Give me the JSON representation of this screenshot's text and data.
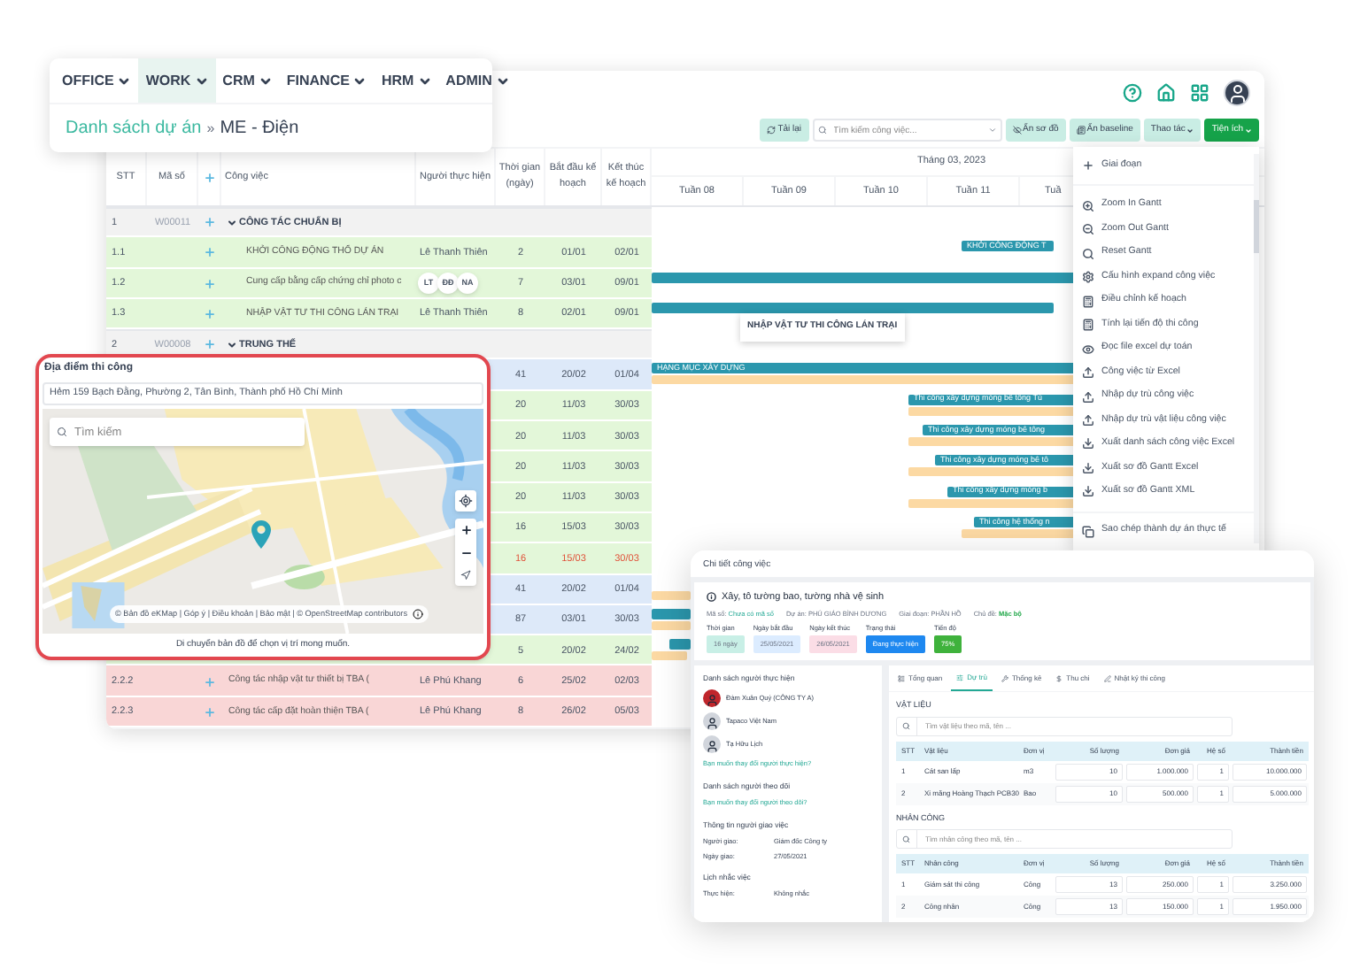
{
  "nav": {
    "menus": [
      {
        "label": "OFFICE",
        "selected": false
      },
      {
        "label": "WORK",
        "selected": true
      },
      {
        "label": "CRM",
        "selected": false
      },
      {
        "label": "FINANCE",
        "selected": false
      },
      {
        "label": "HRM",
        "selected": false
      },
      {
        "label": "ADMIN",
        "selected": false
      }
    ],
    "breadcrumb": {
      "link": "Danh sách dự án",
      "separator": "»",
      "current": "ME - Điện"
    }
  },
  "toolbar": {
    "reload": "Tải lại",
    "search_placeholder": "Tìm kiếm công việc...",
    "buttons": [
      {
        "label": "Ẩn sơ đồ",
        "kind": "light"
      },
      {
        "label": "Ẩn baseline",
        "kind": "light"
      },
      {
        "label": "Thao tác",
        "kind": "menu"
      },
      {
        "label": "Tiện ích",
        "kind": "primary"
      }
    ]
  },
  "table": {
    "columns": [
      "STT",
      "Mã số",
      "Công việc",
      "Người thực hiện",
      "Thời gian (ngày)",
      "Bắt đầu kế hoạch",
      "Kết thúc kế hoạch"
    ],
    "month": "Tháng 03, 2023",
    "weeks": [
      "Tuần 08",
      "Tuần 09",
      "Tuần 10",
      "Tuần 11",
      "Tuầ"
    ],
    "rows": [
      {
        "kind": "group",
        "color": "#f2f2f2",
        "stt": "1",
        "code": "W00011",
        "name": "CÔNG TÁC CHUẨN BỊ",
        "expanded": true,
        "bar": false,
        "baseline": false
      },
      {
        "kind": "task",
        "color": "#e3f7d9",
        "stt": "1.1",
        "name": "KHỞI CÔNG ĐỘNG THỔ DỰ ÁN",
        "assignee": "Lê Thanh Thiên",
        "days": "2",
        "start": "01/01",
        "end": "02/01",
        "late": false,
        "bar": true,
        "bar_label": "KHỞI CÔNG ĐỘNG T",
        "baseline": false
      },
      {
        "kind": "task",
        "color": "#e3f7d9",
        "stt": "1.2",
        "name": "Cung cấp bằng cấp chứng chỉ photo c",
        "avatars": [
          "LT",
          "ĐĐ",
          "NA"
        ],
        "days": "7",
        "start": "03/01",
        "end": "09/01",
        "late": false,
        "bar": true,
        "baseline": false
      },
      {
        "kind": "task",
        "color": "#e3f7d9",
        "stt": "1.3",
        "name": "NHẬP VẬT TƯ THI CÔNG LÁN TRẠI",
        "assignee": "Lê Thanh Thiên",
        "days": "8",
        "start": "02/01",
        "end": "09/01",
        "late": false,
        "bar": true,
        "baseline": false
      },
      {
        "kind": "group",
        "color": "#f2f2f2",
        "stt": "2",
        "code": "W00008",
        "name": "TRUNG THẾ",
        "expanded": true,
        "bar": false,
        "baseline": false
      },
      {
        "kind": "task",
        "color": "#dde9f9",
        "days": "41",
        "start": "20/02",
        "end": "01/04",
        "late": false,
        "bar": true,
        "bar_label": "HẠNG MỤC XÂY DỰNG",
        "baseline": true
      },
      {
        "kind": "task",
        "color": "#e3f7d9",
        "days": "20",
        "start": "11/03",
        "end": "30/03",
        "late": false,
        "bar": true,
        "bar_label": "Thi công xây dựng móng bê tông Tủ",
        "baseline": true
      },
      {
        "kind": "task",
        "color": "#e3f7d9",
        "days": "20",
        "start": "11/03",
        "end": "30/03",
        "late": false,
        "bar": true,
        "bar_label": "Thi công xây dựng móng bê tông",
        "baseline": true
      },
      {
        "kind": "task",
        "color": "#e3f7d9",
        "days": "20",
        "start": "11/03",
        "end": "30/03",
        "late": false,
        "bar": true,
        "bar_label": "Thi công xây dựng móng bê tô",
        "baseline": true
      },
      {
        "kind": "task",
        "color": "#e3f7d9",
        "days": "20",
        "start": "11/03",
        "end": "30/03",
        "late": false,
        "bar": true,
        "bar_label": "Thi công xây dựng móng b",
        "baseline": true
      },
      {
        "kind": "task",
        "color": "#e3f7d9",
        "days": "16",
        "start": "15/03",
        "end": "30/03",
        "late": false,
        "bar": true,
        "bar_label": "Thi công hệ thống n",
        "baseline": true
      },
      {
        "kind": "task",
        "color": "#e3f7d9",
        "days": "16",
        "start": "15/03",
        "end": "30/03",
        "late": true,
        "bar": false,
        "baseline": false
      },
      {
        "kind": "task",
        "color": "#dde9f9",
        "days": "41",
        "start": "20/02",
        "end": "01/04",
        "late": false,
        "bar": false,
        "baseline": true
      },
      {
        "kind": "task",
        "color": "#dde9f9",
        "days": "87",
        "start": "03/01",
        "end": "30/03",
        "late": false,
        "bar": true,
        "baseline": true
      },
      {
        "kind": "task",
        "color": "#e3f7d9",
        "days": "5",
        "start": "20/02",
        "end": "24/02",
        "late": false,
        "bar": true,
        "baseline": true
      },
      {
        "kind": "task",
        "color": "#f9d6d6",
        "stt": "2.2.2",
        "name": "Công tác nhập vật tư thiết bị TBA (",
        "assignee": "Lê Phú Khang",
        "days": "6",
        "start": "25/02",
        "end": "02/03",
        "late": false,
        "bar": false,
        "baseline": false
      },
      {
        "kind": "task",
        "color": "#f9d6d6",
        "stt": "2.2.3",
        "name": "Công tác cấp đặt hoàn thiện TBA (",
        "assignee": "Lê Phú Khang",
        "days": "8",
        "start": "26/02",
        "end": "05/03",
        "late": false,
        "bar": false,
        "baseline": false
      }
    ],
    "tooltip": "NHẬP VẬT TƯ THI CÔNG LÁN TRẠI"
  },
  "menu": {
    "items": [
      {
        "label": "Giai đoạn",
        "kind": "plus"
      },
      {
        "kind": "divider"
      },
      {
        "label": "Zoom In Gantt",
        "kind": "zoom-in"
      },
      {
        "label": "Zoom Out Gantt",
        "kind": "zoom-out"
      },
      {
        "label": "Reset Gantt",
        "kind": "search"
      },
      {
        "label": "Cấu hình expand công việc",
        "kind": "gear"
      },
      {
        "label": "Điều chỉnh kế hoạch",
        "kind": "half"
      },
      {
        "label": "Tính lại tiến độ thi công",
        "kind": "calc"
      },
      {
        "label": "Đọc file excel dự toán",
        "kind": "eye"
      },
      {
        "label": "Công việc từ Excel",
        "kind": "upload"
      },
      {
        "label": "Nhập dự trù công việc",
        "kind": "upload"
      },
      {
        "label": "Nhập dự trù vật liệu công việc",
        "kind": "upload"
      },
      {
        "label": "Xuất danh sách công việc Excel",
        "kind": "download"
      },
      {
        "label": "Xuất sơ đồ Gantt Excel",
        "kind": "download"
      },
      {
        "label": "Xuất sơ đồ Gantt XML",
        "kind": "download"
      },
      {
        "kind": "divider"
      },
      {
        "label": "Sao chép thành dự án thực tế",
        "kind": "copy"
      }
    ]
  },
  "map": {
    "title": "Địa điểm thi công",
    "address": "Hẻm 159 Bạch Đằng, Phường 2, Tân Bình, Thành phố Hồ Chí Minh",
    "search_placeholder": "Tìm kiếm",
    "attribution": "© Bản đồ eKMap | Góp ý | Điều khoản | Bảo mật | © OpenStreetMap contributors",
    "hint": "Di chuyển bản đồ để chọn vị trí mong muốn."
  },
  "detail": {
    "title": "Chi tiết công việc",
    "task": "Xây, tô tường bao, tường nhà vệ sinh",
    "meta": [
      {
        "label": "Mã số:",
        "value": "Chưa có mã số",
        "kind": "link"
      },
      {
        "label": "Dự án:",
        "value": "PHÚ GIÁO BÌNH DƯƠNG",
        "kind": "plain"
      },
      {
        "label": "Giai đoạn:",
        "value": "PHẦN HỒ",
        "kind": "plain"
      },
      {
        "label": "Chủ đề:",
        "value": "Mặc bộ",
        "kind": "green"
      }
    ],
    "pills": [
      {
        "label": "Thời gian",
        "value": "16 ngày",
        "color": "#c8efe6"
      },
      {
        "label": "Ngày bắt đầu",
        "value": "25/05/2021",
        "color": "#dcecff"
      },
      {
        "label": "Ngày kết thúc",
        "value": "26/05/2021",
        "color": "#fbdde6"
      },
      {
        "label": "Trạng thái",
        "value": "Đang thực hiện",
        "color": "#1e88f0"
      },
      {
        "label": "Tiến độ",
        "value": "75%",
        "color": "#3fb23c"
      }
    ],
    "assignees_title": "Danh sách người thực hiện",
    "assignees": [
      "Đàm Xuân Quý (CÔNG TY A)",
      "Tapaco Việt Nam",
      "Tạ Hữu Lịch"
    ],
    "assignees_link": "Bạn muốn thay đổi người thực hiện?",
    "followers_title": "Danh sách người theo dõi",
    "followers_link": "Bạn muốn thay đổi người theo dõi?",
    "giver_title": "Thông tin người giao việc",
    "giver": [
      {
        "label": "Người giao:",
        "value": "Giám đốc Công ty"
      },
      {
        "label": "Ngày giao:",
        "value": "27/05/2021"
      }
    ],
    "reminder_title": "Lịch nhắc việc",
    "reminder": [
      {
        "label": "Thực hiện:",
        "value": "Không nhắc"
      }
    ],
    "tabs": [
      {
        "label": "Tổng quan",
        "selected": false
      },
      {
        "label": "Dự trù",
        "selected": true
      },
      {
        "label": "Thống kê",
        "selected": false
      },
      {
        "label": "Thu chi",
        "selected": false
      },
      {
        "label": "Nhật ký thi công",
        "selected": false
      }
    ],
    "sections": [
      {
        "title": "VẬT LIỆU",
        "placeholder": "Tìm vật liệu theo mã, tên ...",
        "columns": [
          "STT",
          "Vật liệu",
          "Đơn vị",
          "Số lượng",
          "Đơn giá",
          "Hệ số",
          "Thành tiền"
        ],
        "rows": [
          [
            "1",
            "Cát san lấp",
            "m3",
            "10",
            "1.000.000",
            "1",
            "10.000.000"
          ],
          [
            "2",
            "Xi măng Hoàng Thạch PCB30",
            "Bao",
            "10",
            "500.000",
            "1",
            "5.000.000"
          ]
        ]
      },
      {
        "title": "NHÂN CÔNG",
        "placeholder": "Tìm nhân công theo mã, tên ...",
        "columns": [
          "STT",
          "Nhân công",
          "Đơn vị",
          "Số lượng",
          "Đơn giá",
          "Hệ số",
          "Thành tiền"
        ],
        "rows": [
          [
            "1",
            "Giám sát thi công",
            "Công",
            "13",
            "250.000",
            "1",
            "3.250.000"
          ],
          [
            "2",
            "Công nhân",
            "Công",
            "13",
            "150.000",
            "1",
            "1.950.000"
          ]
        ]
      }
    ]
  }
}
